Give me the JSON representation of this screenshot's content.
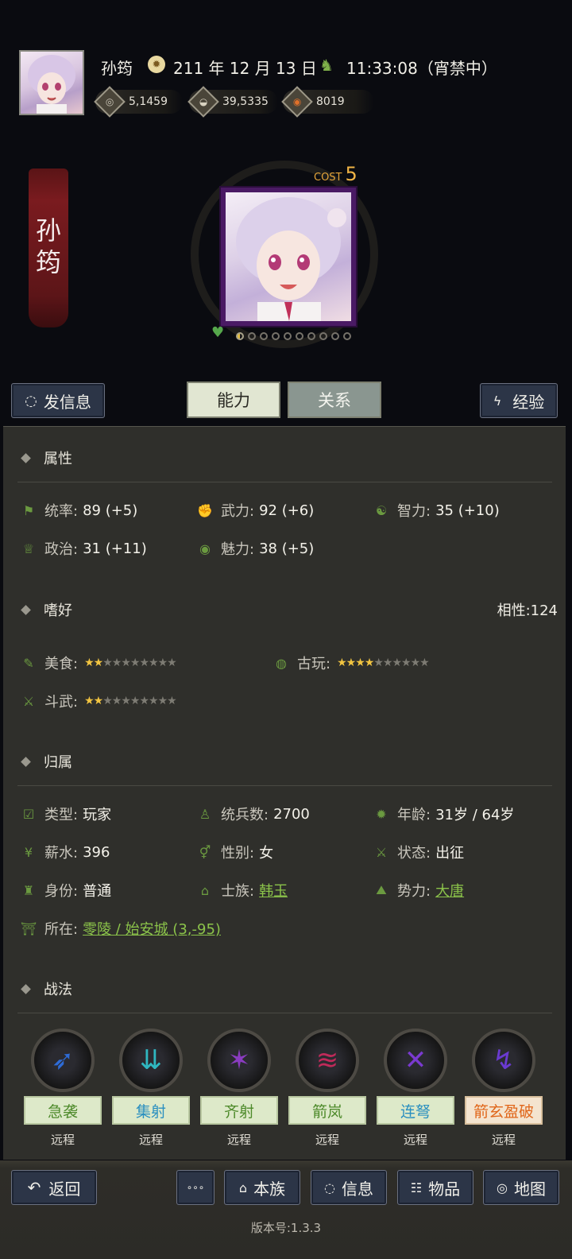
{
  "header": {
    "player_name": "孙筠",
    "date": "211 年 12 月 13 日",
    "time": "11:33:08（宵禁中）",
    "resources": [
      {
        "icon": "silver-coin-icon",
        "value": "5,1459"
      },
      {
        "icon": "grain-icon",
        "value": "39,5335"
      },
      {
        "icon": "gold-ingot-icon",
        "value": "8019"
      }
    ]
  },
  "character": {
    "name_vertical": "孙\n筠",
    "cost_label": "COST",
    "cost_value": "5"
  },
  "actions": {
    "message": "发信息",
    "tab_ability": "能力",
    "tab_relation": "关系",
    "experience": "经验"
  },
  "attributes": {
    "title": "属性",
    "items": [
      {
        "label": "统率:",
        "value": "89 (+5)"
      },
      {
        "label": "武力:",
        "value": "92 (+6)"
      },
      {
        "label": "智力:",
        "value": "35 (+10)"
      },
      {
        "label": "政治:",
        "value": "31 (+11)"
      },
      {
        "label": "魅力:",
        "value": "38 (+5)"
      }
    ]
  },
  "hobbies": {
    "title": "嗜好",
    "affinity": "相性:124",
    "items": [
      {
        "label": "美食:",
        "stars": 2,
        "max": 10
      },
      {
        "label": "古玩:",
        "stars": 4,
        "max": 10
      },
      {
        "label": "斗武:",
        "stars": 2,
        "max": 10
      }
    ]
  },
  "belonging": {
    "title": "归属",
    "type_label": "类型:",
    "type_value": "玩家",
    "troops_label": "统兵数:",
    "troops_value": "2700",
    "age_label": "年龄:",
    "age_value": "31岁 / 64岁",
    "salary_label": "薪水:",
    "salary_value": "396",
    "gender_label": "性别:",
    "gender_value": "女",
    "status_label": "状态:",
    "status_value": "出征",
    "identity_label": "身份:",
    "identity_value": "普通",
    "clan_label": "士族:",
    "clan_value": "韩玉",
    "faction_label": "势力:",
    "faction_value": "大唐",
    "location_label": "所在:",
    "location_value": "零陵 / 始安城 (3,-95)"
  },
  "tactics": {
    "title": "战法",
    "items": [
      {
        "name": "急袭",
        "type": "远程",
        "color": "#4d8a2a",
        "glyph": "➶",
        "glyph_color": "#2e6bd6"
      },
      {
        "name": "集射",
        "type": "远程",
        "color": "#2a8fc0",
        "glyph": "⇊",
        "glyph_color": "#2fb7c0"
      },
      {
        "name": "齐射",
        "type": "远程",
        "color": "#4d8a2a",
        "glyph": "✶",
        "glyph_color": "#8a3cc0"
      },
      {
        "name": "箭岚",
        "type": "远程",
        "color": "#4d8a2a",
        "glyph": "≋",
        "glyph_color": "#c02a5a"
      },
      {
        "name": "连弩",
        "type": "远程",
        "color": "#2a8fc0",
        "glyph": "✕",
        "glyph_color": "#7a3ad0"
      },
      {
        "name": "箭玄盈破",
        "type": "远程",
        "color": "#e0661a",
        "glyph": "↯",
        "glyph_color": "#6a3ad0"
      }
    ]
  },
  "bottom_nav": {
    "back": "返回",
    "more": "∘∘∘",
    "clan": "本族",
    "info": "信息",
    "items": "物品",
    "map": "地图"
  },
  "version": "版本号:1.3.3"
}
